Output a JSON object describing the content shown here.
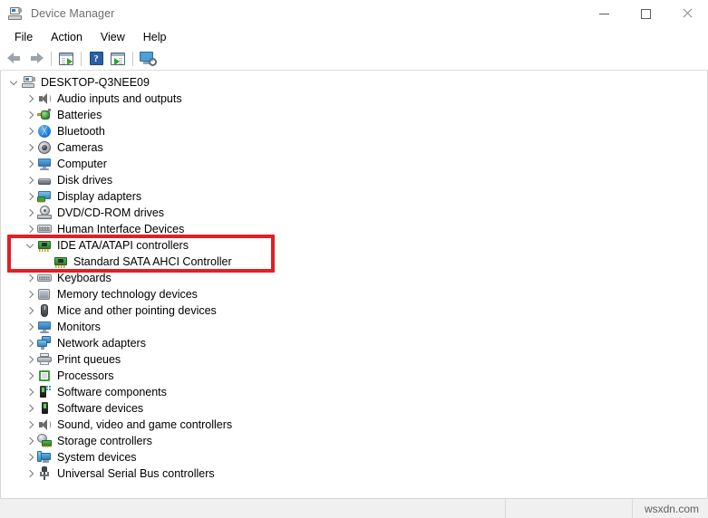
{
  "window": {
    "title": "Device Manager",
    "icon": "device-manager-icon",
    "controls": {
      "minimize": "─",
      "maximize": "□",
      "close": "✕"
    }
  },
  "menubar": {
    "items": [
      {
        "label": "File",
        "name": "menu-file"
      },
      {
        "label": "Action",
        "name": "menu-action"
      },
      {
        "label": "View",
        "name": "menu-view"
      },
      {
        "label": "Help",
        "name": "menu-help"
      }
    ]
  },
  "toolbar": {
    "buttons": [
      {
        "name": "back-button",
        "icon": "back-arrow-icon",
        "tooltip": "Back"
      },
      {
        "name": "forward-button",
        "icon": "forward-arrow-icon",
        "tooltip": "Forward"
      },
      {
        "name": "show-hide-console-tree-button",
        "icon": "console-tree-icon",
        "tooltip": "Show/hide console tree"
      },
      {
        "name": "help-button",
        "icon": "help-question-icon",
        "tooltip": "Help"
      },
      {
        "name": "properties-button",
        "icon": "properties-window-icon",
        "tooltip": "Properties"
      },
      {
        "name": "scan-hardware-changes-button",
        "icon": "scan-hardware-changes-icon",
        "tooltip": "Scan for hardware changes"
      }
    ]
  },
  "tree": {
    "root": {
      "label": "DESKTOP-Q3NEE09",
      "icon": "computer-root-icon",
      "expanded": true
    },
    "items": [
      {
        "label": "Audio inputs and outputs",
        "icon": "speaker-icon",
        "icon_class": "ic-speaker",
        "level": 1,
        "expanded": false
      },
      {
        "label": "Batteries",
        "icon": "battery-icon",
        "icon_class": "ic-battery",
        "level": 1,
        "expanded": false
      },
      {
        "label": "Bluetooth",
        "icon": "bluetooth-icon",
        "icon_class": "ic-bluetooth",
        "level": 1,
        "expanded": false
      },
      {
        "label": "Cameras",
        "icon": "camera-icon",
        "icon_class": "ic-camera",
        "level": 1,
        "expanded": false
      },
      {
        "label": "Computer",
        "icon": "monitor-icon",
        "icon_class": "ic-monitor",
        "level": 1,
        "expanded": false
      },
      {
        "label": "Disk drives",
        "icon": "disk-drive-icon",
        "icon_class": "ic-disk",
        "level": 1,
        "expanded": false
      },
      {
        "label": "Display adapters",
        "icon": "display-adapter-icon",
        "icon_class": "ic-display",
        "level": 1,
        "expanded": false
      },
      {
        "label": "DVD/CD-ROM drives",
        "icon": "dvd-drive-icon",
        "icon_class": "ic-dvd",
        "level": 1,
        "expanded": false
      },
      {
        "label": "Human Interface Devices",
        "icon": "hid-icon",
        "icon_class": "ic-hid",
        "level": 1,
        "expanded": false
      },
      {
        "label": "IDE ATA/ATAPI controllers",
        "icon": "ide-controller-icon",
        "icon_class": "ic-ide",
        "level": 1,
        "expanded": true,
        "highlighted": true
      },
      {
        "label": "Standard SATA AHCI Controller",
        "icon": "ide-controller-icon",
        "icon_class": "ic-ide",
        "level": 2,
        "expanded": false,
        "highlighted": true
      },
      {
        "label": "Keyboards",
        "icon": "keyboard-icon",
        "icon_class": "ic-keyboard",
        "level": 1,
        "expanded": false
      },
      {
        "label": "Memory technology devices",
        "icon": "memory-tech-icon",
        "icon_class": "ic-memtech",
        "level": 1,
        "expanded": false
      },
      {
        "label": "Mice and other pointing devices",
        "icon": "mouse-icon",
        "icon_class": "ic-mouse",
        "level": 1,
        "expanded": false
      },
      {
        "label": "Monitors",
        "icon": "monitor-icon",
        "icon_class": "ic-monitor",
        "level": 1,
        "expanded": false
      },
      {
        "label": "Network adapters",
        "icon": "network-adapter-icon",
        "icon_class": "ic-network",
        "level": 1,
        "expanded": false
      },
      {
        "label": "Print queues",
        "icon": "printer-icon",
        "icon_class": "ic-print",
        "level": 1,
        "expanded": false
      },
      {
        "label": "Processors",
        "icon": "processor-icon",
        "icon_class": "ic-proc",
        "level": 1,
        "expanded": false
      },
      {
        "label": "Software components",
        "icon": "software-component-icon",
        "icon_class": "ic-softcomp",
        "level": 1,
        "expanded": false
      },
      {
        "label": "Software devices",
        "icon": "software-device-icon",
        "icon_class": "ic-softdev",
        "level": 1,
        "expanded": false
      },
      {
        "label": "Sound, video and game controllers",
        "icon": "speaker-icon",
        "icon_class": "ic-speaker",
        "level": 1,
        "expanded": false
      },
      {
        "label": "Storage controllers",
        "icon": "storage-controller-icon",
        "icon_class": "ic-storage",
        "level": 1,
        "expanded": false
      },
      {
        "label": "System devices",
        "icon": "system-device-icon",
        "icon_class": "ic-sysdev",
        "level": 1,
        "expanded": false
      },
      {
        "label": "Universal Serial Bus controllers",
        "icon": "usb-icon",
        "icon_class": "ic-usb",
        "level": 1,
        "expanded": false
      }
    ]
  },
  "highlight": {
    "color": "#e01f26",
    "label": "IDE ATA/ATAPI controllers highlight"
  },
  "statusbar": {
    "pane1": "",
    "pane2": "",
    "watermark": "wsxdn.com"
  }
}
